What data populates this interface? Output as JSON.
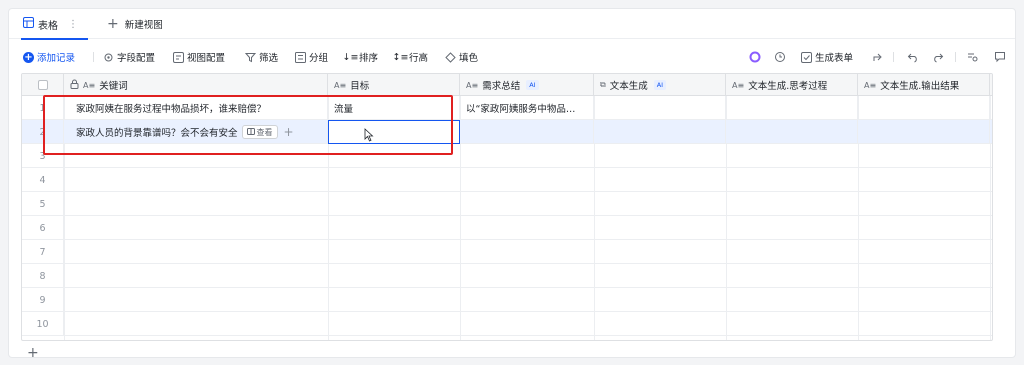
{
  "tabs": {
    "active_label": "表格",
    "more_glyph": "⋮",
    "new_view_label": "新建视图"
  },
  "toolbar": {
    "add_record": "添加记录",
    "field_config": "字段配置",
    "view_config": "视图配置",
    "filter": "筛选",
    "group": "分组",
    "sort": "排序",
    "row_height": "行高",
    "fill_color": "填色",
    "generate_form": "生成表单"
  },
  "columns": [
    {
      "label": "关键词",
      "icon": "A≡",
      "locked": true,
      "ai": false
    },
    {
      "label": "目标",
      "icon": "A≡",
      "ai": false
    },
    {
      "label": "需求总结",
      "icon": "A≡",
      "ai": true
    },
    {
      "label": "文本生成",
      "icon": "⧉",
      "ai": true
    },
    {
      "label": "文本生成.思考过程",
      "icon": "A≡",
      "ai": false
    },
    {
      "label": "文本生成.输出结果",
      "icon": "A≡",
      "ai": false
    }
  ],
  "ai_badge": "AI",
  "rows": [
    {
      "num": "1",
      "keyword": "家政阿姨在服务过程中物品损坏，谁来赔偿？",
      "goal": "流量",
      "summary": "以“家政阿姨服务中物品…"
    },
    {
      "num": "2",
      "keyword": "家政人员的背景靠谱吗？会不会有安全",
      "goal": "",
      "summary": ""
    },
    {
      "num": "3"
    },
    {
      "num": "4"
    },
    {
      "num": "5"
    },
    {
      "num": "6"
    },
    {
      "num": "7"
    },
    {
      "num": "8"
    },
    {
      "num": "9"
    },
    {
      "num": "10"
    }
  ],
  "row_actions": {
    "view_label": "查看",
    "plus": "+"
  },
  "colors": {
    "accent": "#1456f0",
    "highlight": "#e02020",
    "selected_row": "#eaf1ff"
  }
}
